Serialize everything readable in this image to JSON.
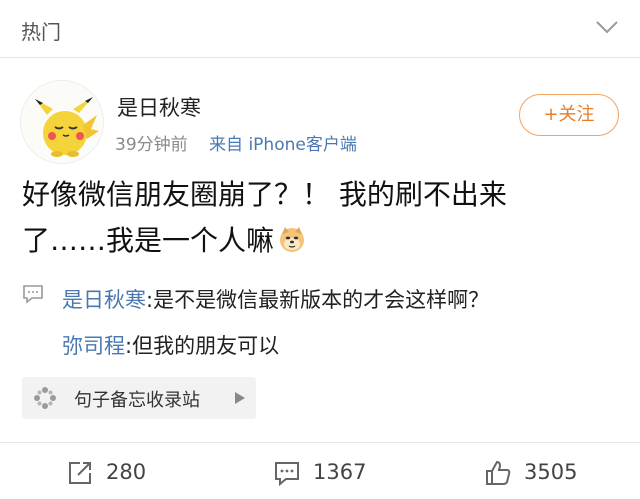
{
  "header": {
    "title": "热门"
  },
  "post": {
    "author": "是日秋寒",
    "time": "39分钟前",
    "source": "来自 iPhone客户端",
    "follow_label": "+关注",
    "text_line1": "好像微信朋友圈崩了？！ 我的刷不出来",
    "text_line2": "了……我是一个人嘛",
    "emoji_name": "doge-emoji"
  },
  "comments": [
    {
      "author": "是日秋寒",
      "text": ":是不是微信最新版本的才会这样啊？"
    },
    {
      "author": "弥司程",
      "text": ":但我的朋友可以"
    }
  ],
  "supertopic": {
    "label": "句子备忘收录站"
  },
  "actions": {
    "repost_count": "280",
    "comment_count": "1367",
    "like_count": "3505"
  }
}
